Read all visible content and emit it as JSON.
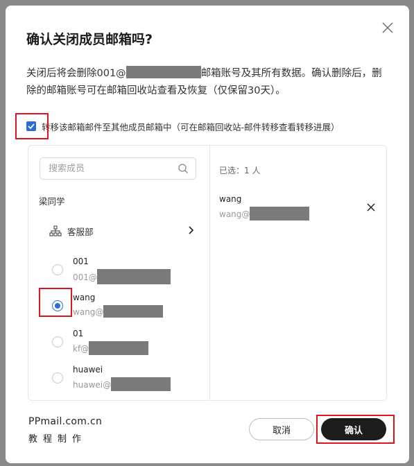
{
  "dialog": {
    "title": "确认关闭成员邮箱吗?",
    "description_part1": "关闭后将会删除001@",
    "description_part2": "邮箱账号及其所有数据。确认删除后，删除的邮箱账号可在邮箱回收站查看及恢复（仅保留30天）。",
    "transfer_checked": true,
    "transfer_label": "转移该邮箱邮件至其他成员邮箱中（可在邮箱回收站-邮件转移查看转移进展）"
  },
  "picker": {
    "search_placeholder": "搜索成员",
    "org_name": "梁同学",
    "department": "客服部",
    "members": [
      {
        "name": "001",
        "email_prefix": "001@",
        "selected": false
      },
      {
        "name": "wang",
        "email_prefix": "wang@",
        "selected": true
      },
      {
        "name": "01",
        "email_prefix": "kf@",
        "selected": false
      },
      {
        "name": "huawei",
        "email_prefix": "huawei@",
        "selected": false
      }
    ],
    "selected_count_label": "已选：1 人",
    "selected": {
      "name": "wang",
      "email_prefix": "wang@"
    }
  },
  "footer": {
    "brand_main": "PPmail.com.cn",
    "brand_sub": "教程制作",
    "cancel_label": "取消",
    "confirm_label": "确认"
  },
  "colors": {
    "accent": "#2d6bd8",
    "confirm_bg": "#1c1c1c",
    "highlight": "#e0141e"
  },
  "icons": [
    "close-icon",
    "check-icon",
    "search-icon",
    "org-tree-icon",
    "chevron-right-icon",
    "remove-icon"
  ]
}
